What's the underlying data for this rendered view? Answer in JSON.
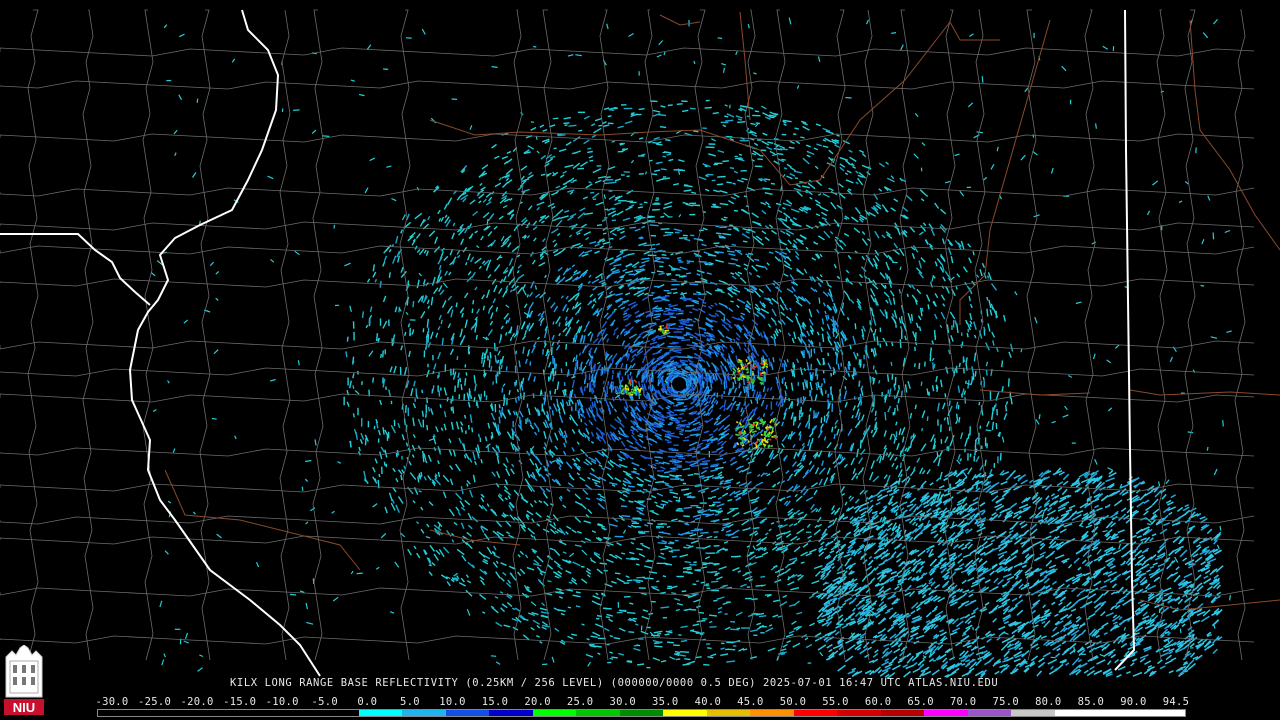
{
  "caption": "KILX LONG RANGE BASE REFLECTIVITY (0.25KM / 256 LEVEL) (000000/0000 0.5 DEG) 2025-07-01 16:47 UTC  ATLAS.NIU.EDU",
  "legend": {
    "ticks": [
      "-30.0",
      "-25.0",
      "-20.0",
      "-15.0",
      "-10.0",
      "-5.0",
      "0.0",
      "5.0",
      "10.0",
      "15.0",
      "20.0",
      "25.0",
      "30.0",
      "35.0",
      "40.0",
      "45.0",
      "50.0",
      "55.0",
      "60.0",
      "65.0",
      "70.0",
      "75.0",
      "80.0",
      "85.0",
      "90.0",
      "94.5"
    ],
    "colors": [
      "#000000",
      "#000000",
      "#000000",
      "#000000",
      "#000000",
      "#000000",
      "#00ffff",
      "#1fb4f0",
      "#1450e6",
      "#0000c8",
      "#00ff00",
      "#00c800",
      "#008c00",
      "#ffff00",
      "#e6be00",
      "#ff9100",
      "#ff0000",
      "#d20000",
      "#b40000",
      "#ff00ff",
      "#9955c9",
      "#c8c8c8",
      "#ffffff",
      "#ffffff",
      "#ffffff"
    ]
  },
  "logo": {
    "text": "NIU",
    "color": "#c8102e"
  },
  "map_colors": {
    "background": "#000000",
    "county_lines": "#707070",
    "state_lines": "#ffffff",
    "highways": "#8b4a2b",
    "echo_light": "#22d0d8",
    "echo_mid": "#1f9ce8",
    "echo_strong": "#1d5fd8",
    "cell_green": "#3cd23c",
    "cell_yellow": "#f0dc00",
    "cell_red": "#e03020",
    "radar_site": "#000000"
  }
}
